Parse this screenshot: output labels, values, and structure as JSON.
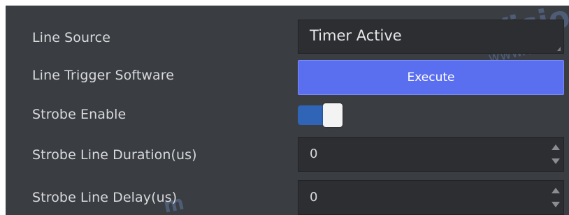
{
  "params": {
    "line_source": {
      "label": "Line  Source",
      "value": "Timer Active"
    },
    "line_trigger_software": {
      "label": "Line Trigger Software",
      "button": "Execute"
    },
    "strobe_enable": {
      "label": "Strobe Enable",
      "on": true
    },
    "strobe_line_duration": {
      "label": "Strobe Line Duration(us)",
      "value": "0"
    },
    "strobe_line_delay": {
      "label": "Strobe Line Delay(us)",
      "value": "0"
    }
  },
  "colors": {
    "panel": "#3a3d42",
    "field": "#2c2e32",
    "button": "#5a6ef0",
    "toggle_on": "#2f64b7"
  }
}
